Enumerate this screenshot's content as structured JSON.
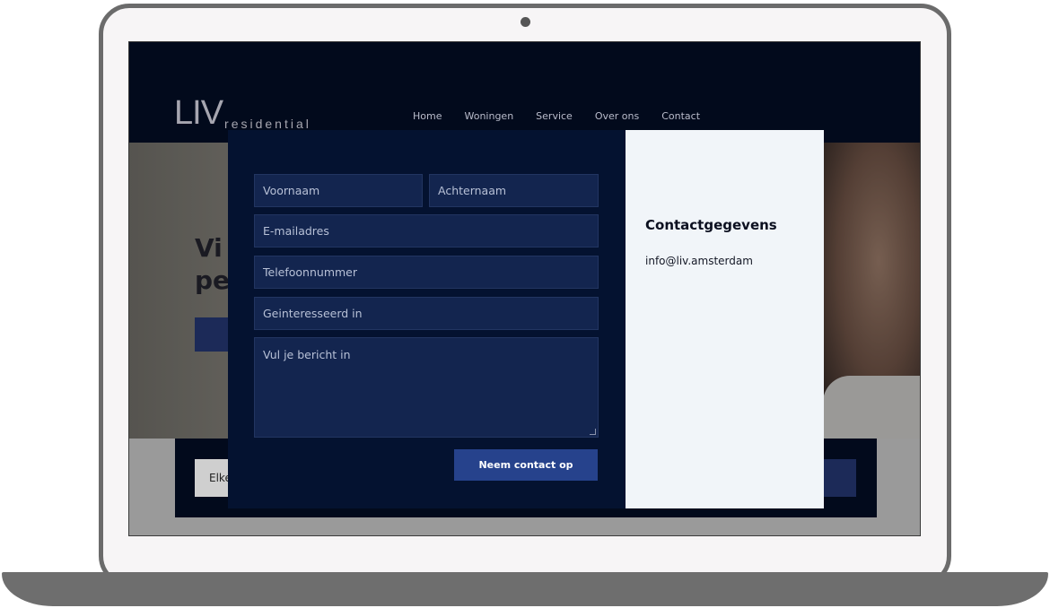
{
  "site": {
    "logo_mark": "LIV",
    "logo_word": "residential",
    "nav": [
      "Home",
      "Woningen",
      "Service",
      "Over ons",
      "Contact"
    ],
    "hero_title_partial": "Vi\npe",
    "hero_button_partial": "",
    "strip_input_partial": "Elke"
  },
  "form": {
    "fields": {
      "first_name": "Voornaam",
      "last_name": "Achternaam",
      "email": "E-mailadres",
      "phone": "Telefoonnummer",
      "interest": "Geinteresseerd in",
      "message": "Vul je bericht in"
    },
    "submit_label": "Neem contact op"
  },
  "contact_info": {
    "title": "Contactgegevens",
    "email": "info@liv.amsterdam"
  },
  "colors": {
    "header_bg": "#020a1c",
    "form_bg": "#041230",
    "field_bg": "#13254f",
    "button_bg": "#26428c",
    "info_bg": "#f1f5f9"
  }
}
